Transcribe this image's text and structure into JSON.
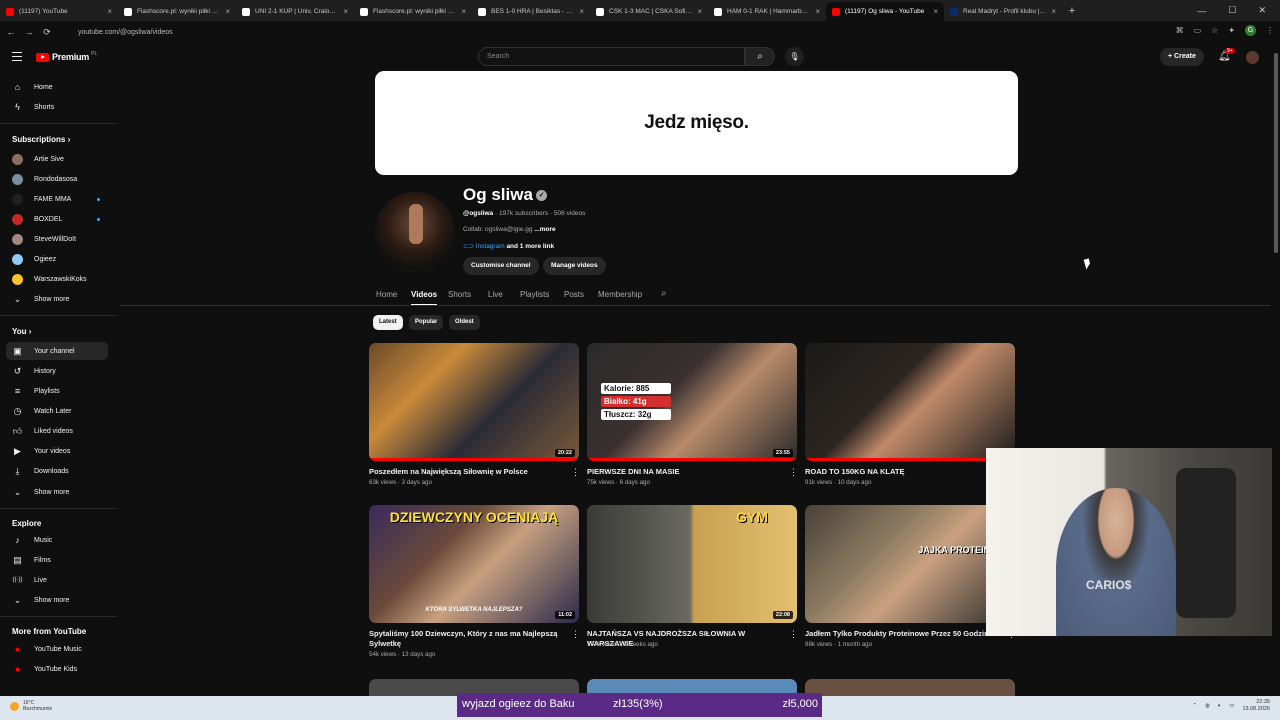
{
  "browser": {
    "tabs": [
      {
        "title": "(11197) YouTube",
        "color": "#ff0000"
      },
      {
        "title": "Flashscore.pl: wyniki piłki nożnej",
        "color": "#ffffff"
      },
      {
        "title": "UNI 2-1 KUP | Univ. Craiova - K",
        "color": "#ffffff"
      },
      {
        "title": "Flashscore.pl: wyniki piłki nożnej",
        "color": "#ffffff"
      },
      {
        "title": "BES 1-0 HRA | Besiktas - Hradec",
        "color": "#ffffff"
      },
      {
        "title": "CSK 1-3 MAC | CSKA Sofia - Mac",
        "color": "#ffffff"
      },
      {
        "title": "HAM 0-1 RAK | Hammarby - Raków",
        "color": "#ffffff"
      },
      {
        "title": "(11197) Og sliwa - YouTube",
        "color": "#ff0000"
      },
      {
        "title": "Real Madryt - Profil klubu | Tran",
        "color": "#0b2a6b"
      }
    ],
    "active_tab": 7,
    "url": "youtube.com/@ogsliwa/videos",
    "profile_initial": "G"
  },
  "header": {
    "logo_text": "Premium",
    "logo_region": "PL",
    "search_placeholder": "Search",
    "create_label": "Create",
    "notif_count": "9+"
  },
  "sidebar": {
    "home": "Home",
    "shorts": "Shorts",
    "subscriptions_title": "Subscriptions",
    "subscriptions": [
      {
        "name": "Artie Sive",
        "color": "#8d6e63",
        "dot": false
      },
      {
        "name": "Rondodasosa",
        "color": "#78909c",
        "dot": false
      },
      {
        "name": "FAME MMA",
        "color": "#212121",
        "dot": true
      },
      {
        "name": "BOXDEL",
        "color": "#c62828",
        "dot": true
      },
      {
        "name": "SteveWillDoIt",
        "color": "#a1887f",
        "dot": false
      },
      {
        "name": "Ogieez",
        "color": "#90caf9",
        "dot": false
      },
      {
        "name": "WarszawskiKoks",
        "color": "#fbc02d",
        "dot": false
      }
    ],
    "show_more_1": "Show more",
    "you_title": "You",
    "you_items": [
      "Your channel",
      "History",
      "Playlists",
      "Watch Later",
      "Liked videos",
      "Your videos",
      "Downloads"
    ],
    "show_more_2": "Show more",
    "explore_title": "Explore",
    "explore_items": [
      "Music",
      "Films",
      "Live"
    ],
    "show_more_3": "Show more",
    "more_title": "More from YouTube",
    "more_items": [
      "YouTube Music",
      "YouTube Kids"
    ]
  },
  "channel": {
    "banner_text": "Jedz mięso.",
    "name": "Og sliwa",
    "handle": "@ogsliwa",
    "stats": "· 197k subscribers · 506 videos",
    "collab": "Collab: ogsliwa@igie.gg",
    "more": "...more",
    "link": "Instagram",
    "link_more": "and 1 more link",
    "customise": "Customise channel",
    "manage": "Manage videos"
  },
  "channel_tabs": [
    "Home",
    "Videos",
    "Shorts",
    "Live",
    "Playlists",
    "Posts",
    "Membership"
  ],
  "active_channel_tab": "Videos",
  "chips": [
    "Latest",
    "Popular",
    "Oldest"
  ],
  "videos": [
    {
      "title": "Poszedłem na Największą Siłownię w Polsce",
      "meta": "63k views · 3 days ago",
      "duration": "20:22",
      "progress": 1.0
    },
    {
      "title": "PIERWSZE DNI NA MASIE",
      "meta": "75k views · 6 days ago",
      "duration": "23:55",
      "progress": 1.0
    },
    {
      "title": "ROAD TO 150KG NA KLATĘ",
      "meta": "91k views · 10 days ago",
      "duration": "",
      "progress": 1.0
    },
    {
      "title": "Spytaliśmy 100 Dziewczyn, Który z nas ma Najlepszą Sylwetkę",
      "meta": "54k views · 13 days ago",
      "duration": "11:02",
      "progress": 0
    },
    {
      "title": "NAJTAŃSZA VS NAJDROŻSZA SIŁOWNIA W WARSZAWIE",
      "meta": "107k views · 3 weeks ago",
      "duration": "22:08",
      "progress": 0
    },
    {
      "title": "Jadłem Tylko Produkty Proteinowe Przez 50 Godzin",
      "meta": "88k views · 1 month ago",
      "duration": "",
      "progress": 0
    }
  ],
  "thumb_text": {
    "nut_kal": "Kalorie: 885",
    "nut_bialko": "Białko: 41g",
    "nut_tluszcz": "Tłuszcz: 32g",
    "dziewczyny": "DZIEWCZYNY OCENIAJĄ",
    "sylwetka": "KTÓRA SYLWETKA NAJLEPSZA?",
    "gym": "GYM",
    "jajka": "JAJKA PROTEINOWE"
  },
  "webcam": {
    "shirt_text": "CARIO$"
  },
  "donation": {
    "message": "wyjazd ogieez do Baku",
    "progress": "zł135(3%)",
    "goal": "zł5,000"
  },
  "taskbar": {
    "temp": "16°C",
    "weather": "Bezchmurnie",
    "time": "22:35",
    "date": "13.08.2026"
  }
}
